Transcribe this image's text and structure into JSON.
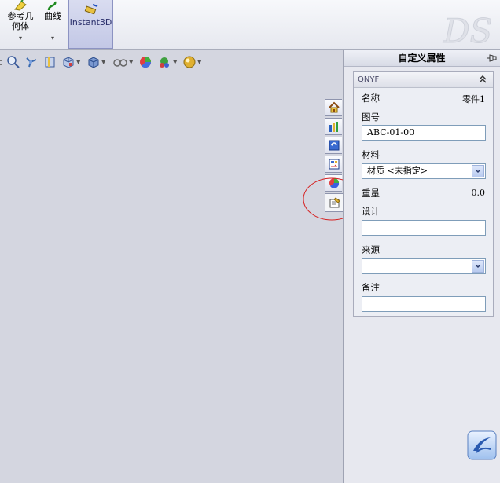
{
  "ribbon": {
    "ref_geometry_label_line1": "参考几",
    "ref_geometry_label_line2": "何体",
    "curves_label": "曲线",
    "instant3d_label": "Instant3D"
  },
  "panel": {
    "title": "自定义属性",
    "group_title": "QNYF",
    "fields": {
      "name_label": "名称",
      "name_value": "零件1",
      "drawing_no_label": "图号",
      "drawing_no_value": "ABC-01-00",
      "material_label": "材料",
      "material_value": "材质 <未指定>",
      "weight_label": "重量",
      "weight_value": "0.0",
      "design_label": "设计",
      "design_value": "",
      "source_label": "来源",
      "source_value": "",
      "remark_label": "备注",
      "remark_value": ""
    }
  },
  "task_tabs": [
    {
      "icon": "home-icon"
    },
    {
      "icon": "design-library-icon"
    },
    {
      "icon": "file-explorer-icon"
    },
    {
      "icon": "view-palette-icon"
    },
    {
      "icon": "appearances-icon"
    },
    {
      "icon": "custom-properties-icon"
    }
  ],
  "colors": {
    "accent": "#7f9db9",
    "highlight_ellipse": "#d62020",
    "graphics_bg": "#d4d6e0"
  }
}
